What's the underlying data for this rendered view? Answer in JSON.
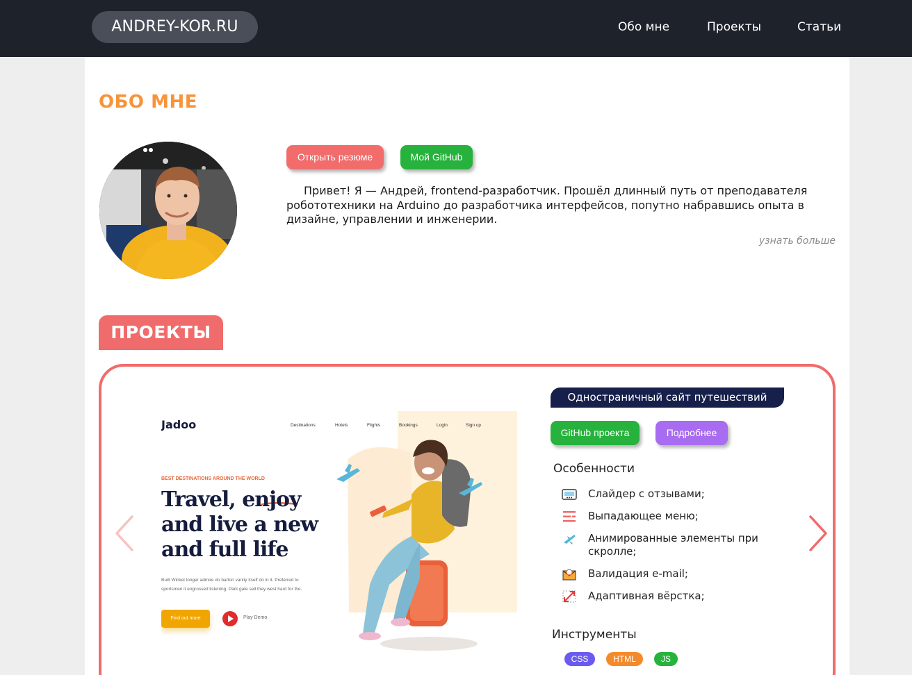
{
  "header": {
    "logo": "ANDREY-KOR.RU",
    "nav": [
      "Обо мне",
      "Проекты",
      "Статьи"
    ]
  },
  "about": {
    "title": "ОБО МНЕ",
    "resume_button": "Открыть резюме",
    "github_button": "Мой GitHub",
    "intro": "Привет! Я — Андрей, frontend-разработчик. Прошёл длинный путь от преподавателя робототехники на Arduino до разработчика интерфейсов, попутно набравшись опыта в дизайне, управлении и инженерии.",
    "more_link": "узнать больше"
  },
  "projects": {
    "title": "ПРОЕКТЫ",
    "current": {
      "name": "Одностраничный сайт путешествий",
      "github_button": "GitHub проекта",
      "details_button": "Подробнее",
      "features_title": "Особенности",
      "features": [
        {
          "icon": "slider-icon",
          "text": "Слайдер с отзывами;"
        },
        {
          "icon": "dropdown-menu-icon",
          "text": "Выпадающее меню;"
        },
        {
          "icon": "airplane-icon",
          "text": "Анимированные элементы при скролле;"
        },
        {
          "icon": "envelope-icon",
          "text": "Валидация e-mail;"
        },
        {
          "icon": "resize-arrow-icon",
          "text": "Адаптивная вёрстка;"
        }
      ],
      "tools_title": "Инструменты",
      "tools": [
        "CSS",
        "HTML",
        "JS"
      ],
      "preview": {
        "logo": "Jadoo",
        "nav": [
          "Destinations",
          "Hotels",
          "Flights",
          "Bookings",
          "Login",
          "Sign up"
        ],
        "kicker": "BEST DESTINATIONS AROUND THE WORLD",
        "headline": "Travel, enjoy and live a new and full life",
        "body": "Built Wicket longer admire do barton vanity itself do in it. Preferred to sportsmen it engrossed listening. Park gate sell they west hard for the.",
        "cta": "Find out more",
        "play": "Play Demo"
      }
    }
  },
  "colors": {
    "header_bg": "#1e222b",
    "accent_orange": "#f7943a",
    "accent_red": "#f06b6b",
    "green": "#26b23c",
    "purple": "#a86cf0",
    "navy": "#17204a"
  }
}
